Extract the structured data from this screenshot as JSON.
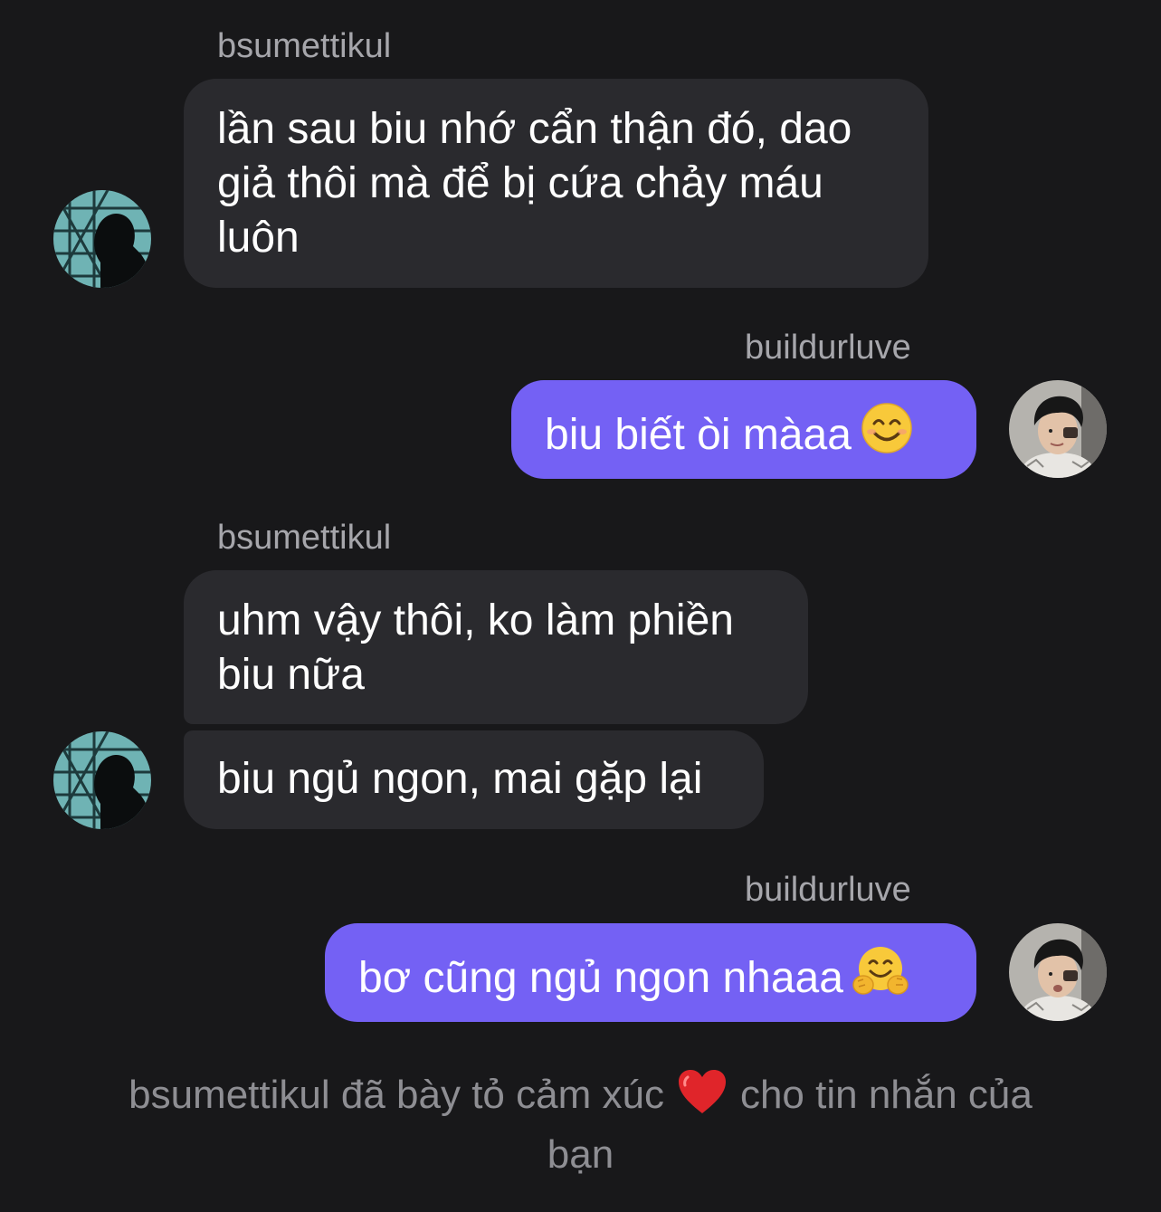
{
  "messages": [
    {
      "sender": "bsumettikul",
      "text": "lần sau biu nhớ cẩn thận đó, dao giả thôi mà để bị cứa chảy máu luôn"
    },
    {
      "sender": "buildurluve",
      "text": "biu biết òi màaa",
      "emoji": "smiling-face-emoji"
    },
    {
      "sender": "bsumettikul",
      "text": "uhm vậy thôi, ko làm phiền biu nữa"
    },
    {
      "text": "biu ngủ ngon, mai gặp lại"
    },
    {
      "sender": "buildurluve",
      "text": "bơ cũng ngủ ngon nhaaa",
      "emoji": "hugging-face-emoji"
    }
  ],
  "reaction_notice": {
    "before": "bsumettikul đã bày tỏ cảm xúc",
    "icon": "red-heart-emoji",
    "after": "cho tin nhắn của bạn"
  },
  "colors": {
    "background": "#18181a",
    "incoming_bubble": "#2a2a2e",
    "outgoing_bubble": "#7461f4",
    "sender_name": "#a6a6ab",
    "notice_text": "#8e8e93"
  }
}
